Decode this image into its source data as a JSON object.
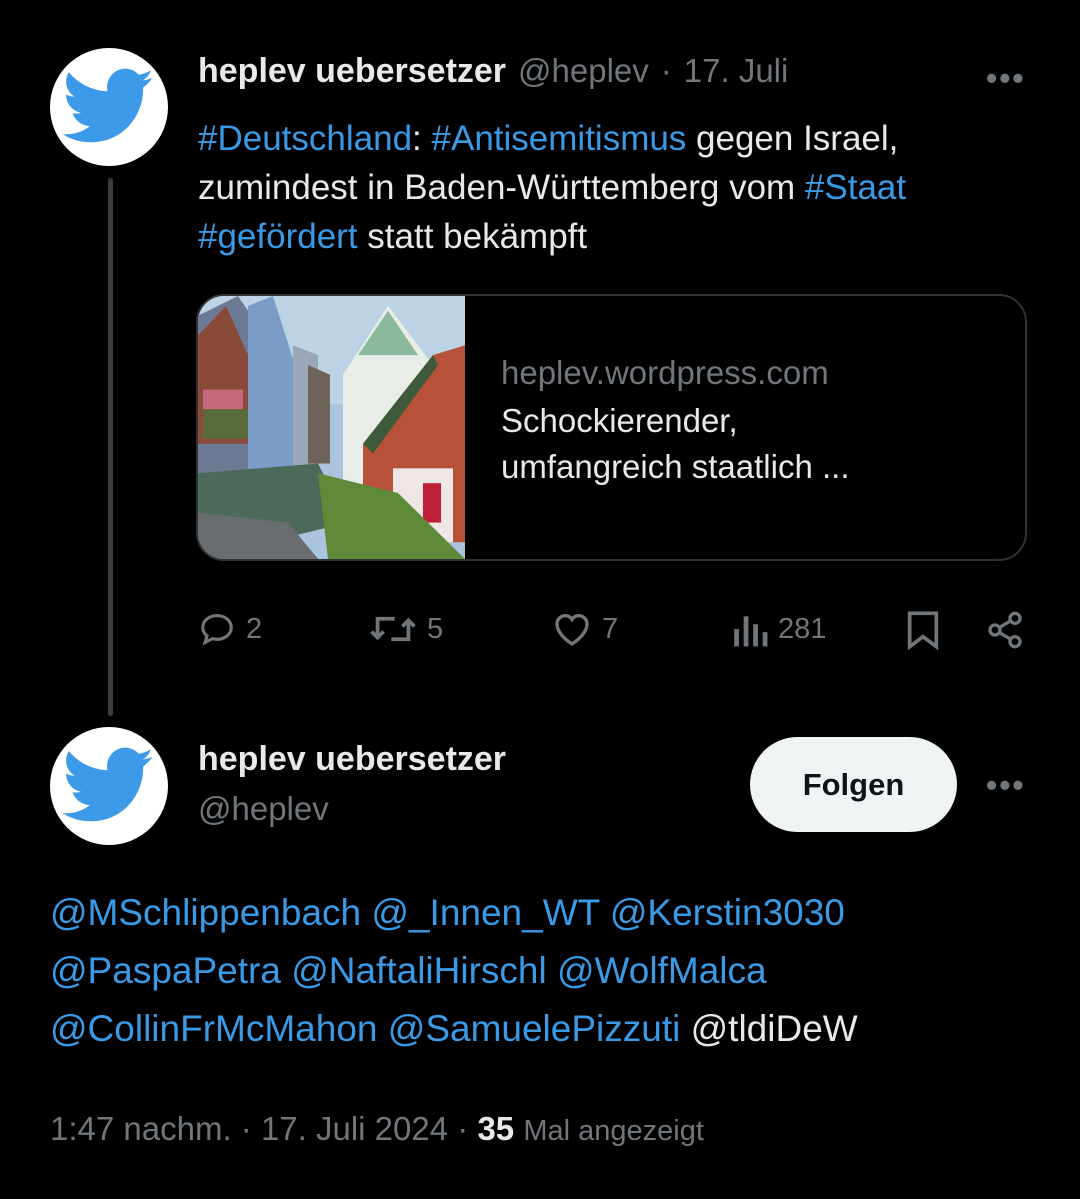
{
  "colors": {
    "background": "#000000",
    "link": "#3a9ae6",
    "muted": "#71767b",
    "text": "#e7e9ea"
  },
  "parent_tweet": {
    "author_name": "heplev uebersetzer",
    "author_handle": "@heplev",
    "separator": "·",
    "date": "17. Juli",
    "more_icon": "more-horizontal-icon",
    "text": {
      "tag_deutschland": "#Deutschland",
      "colon": ":",
      "tag_antisemitismus": "#Antisemitismus",
      "part1": " gegen Israel, zumindest in Baden-Württemberg vom ",
      "tag_staat": "#Staat",
      "space": " ",
      "tag_gefoerdert": "#gefördert",
      "part2": " statt bekämpft"
    },
    "card": {
      "domain": "heplev.wordpress.com",
      "title": "Schockierender, umfangreich staatlich ..."
    },
    "actions": {
      "replies": "2",
      "retweets": "5",
      "likes": "7",
      "views": "281"
    }
  },
  "reply_tweet": {
    "author_name": "heplev uebersetzer",
    "author_handle": "@heplev",
    "follow_label": "Folgen",
    "mentions_linked": [
      "@MSchlippenbach",
      "@_Innen_WT",
      "@Kerstin3030",
      "@PaspaPetra",
      "@NaftaliHirschl",
      "@WolfMalca",
      "@CollinFrMcMahon",
      "@SamuelePizzuti"
    ],
    "mention_plain": "@tldiDeW",
    "timestamp": "1:47 nachm. · 17. Juli 2024",
    "dot": "·",
    "views_count": "35",
    "views_label": "Mal angezeigt"
  }
}
